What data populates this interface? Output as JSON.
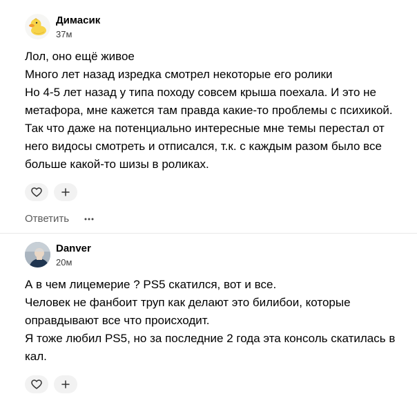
{
  "comments": [
    {
      "author": "Димасик",
      "time": "37м",
      "avatar_icon": "duck-icon",
      "lines": [
        "Лол, оно ещё живое",
        "Много лет назад изредка смотрел некоторые его ролики",
        "Но 4-5 лет назад у типа походу совсем крыша поехала. И это не",
        "метафора, мне кажется там правда какие-то проблемы с психикой.",
        "Так что даже на потенциально интересные мне темы перестал от",
        "него видосы смотреть и отписался, т.к. с каждым разом было все",
        "больше какой-то шизы в роликах."
      ],
      "reply_label": "Ответить"
    },
    {
      "author": "Danver",
      "time": "20м",
      "avatar_icon": "user-photo-icon",
      "lines": [
        "А в чем лицемерие ? PS5 скатился, вот и все.",
        "Человек не фанбоит труп как делают это билибои, которые",
        "оправдывают все что происходит.",
        "Я тоже любил PS5, но за последние 2 года эта консоль скатилась в",
        "кал."
      ]
    }
  ],
  "icons": {
    "like": "heart-icon",
    "react": "plus-icon",
    "more": "more-dots-icon"
  }
}
